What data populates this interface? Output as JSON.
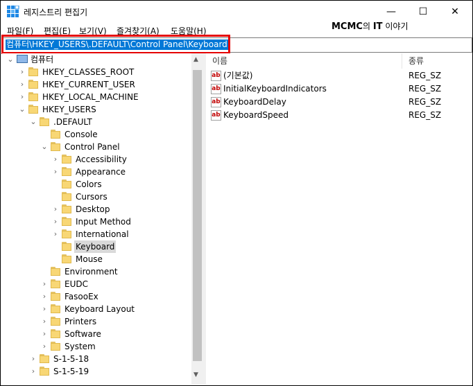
{
  "window": {
    "title": "레지스트리 편집기",
    "controls": {
      "minimize": "—",
      "maximize": "☐",
      "close": "✕"
    }
  },
  "menu": [
    "파일(F)",
    "편집(E)",
    "보기(V)",
    "즐겨찾기(A)",
    "도움말(H)"
  ],
  "watermark": {
    "brand": "MCMC",
    "middle": "의 ",
    "it": "IT",
    "suffix": " 이야기"
  },
  "address": {
    "path": "컴퓨터\\HKEY_USERS\\.DEFAULT\\Control Panel\\Keyboard"
  },
  "tree": {
    "root": "컴퓨터",
    "nodes": [
      {
        "label": "HKEY_CLASSES_ROOT",
        "expander": "collapsed",
        "level": 1
      },
      {
        "label": "HKEY_CURRENT_USER",
        "expander": "collapsed",
        "level": 1
      },
      {
        "label": "HKEY_LOCAL_MACHINE",
        "expander": "collapsed",
        "level": 1
      },
      {
        "label": "HKEY_USERS",
        "expander": "expanded",
        "level": 1
      },
      {
        "label": ".DEFAULT",
        "expander": "expanded",
        "level": 2
      },
      {
        "label": "Console",
        "expander": "none",
        "level": 3
      },
      {
        "label": "Control Panel",
        "expander": "expanded",
        "level": 3
      },
      {
        "label": "Accessibility",
        "expander": "collapsed",
        "level": 4
      },
      {
        "label": "Appearance",
        "expander": "collapsed",
        "level": 4
      },
      {
        "label": "Colors",
        "expander": "none",
        "level": 4
      },
      {
        "label": "Cursors",
        "expander": "none",
        "level": 4
      },
      {
        "label": "Desktop",
        "expander": "collapsed",
        "level": 4
      },
      {
        "label": "Input Method",
        "expander": "collapsed",
        "level": 4
      },
      {
        "label": "International",
        "expander": "collapsed",
        "level": 4
      },
      {
        "label": "Keyboard",
        "expander": "none",
        "level": 4,
        "selected": true
      },
      {
        "label": "Mouse",
        "expander": "none",
        "level": 4
      },
      {
        "label": "Environment",
        "expander": "none",
        "level": 3
      },
      {
        "label": "EUDC",
        "expander": "collapsed",
        "level": 3
      },
      {
        "label": "FasooEx",
        "expander": "collapsed",
        "level": 3
      },
      {
        "label": "Keyboard Layout",
        "expander": "collapsed",
        "level": 3
      },
      {
        "label": "Printers",
        "expander": "collapsed",
        "level": 3
      },
      {
        "label": "Software",
        "expander": "collapsed",
        "level": 3
      },
      {
        "label": "System",
        "expander": "collapsed",
        "level": 3
      },
      {
        "label": "S-1-5-18",
        "expander": "collapsed",
        "level": 2
      },
      {
        "label": "S-1-5-19",
        "expander": "collapsed",
        "level": 2
      }
    ]
  },
  "list": {
    "columns": {
      "name": "이름",
      "type": "종류"
    },
    "rows": [
      {
        "icon": "ab",
        "name": "(기본값)",
        "type": "REG_SZ"
      },
      {
        "icon": "ab",
        "name": "InitialKeyboardIndicators",
        "type": "REG_SZ"
      },
      {
        "icon": "ab",
        "name": "KeyboardDelay",
        "type": "REG_SZ"
      },
      {
        "icon": "ab",
        "name": "KeyboardSpeed",
        "type": "REG_SZ"
      }
    ]
  },
  "colors": {
    "selection": "#0078d7",
    "highlight_box": "#e50000"
  }
}
